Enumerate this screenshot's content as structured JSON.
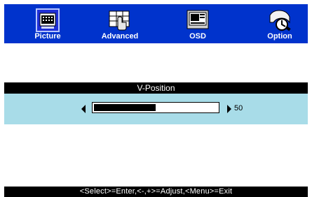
{
  "tabs": [
    {
      "label": "Picture",
      "icon": "picture-icon",
      "selected": true
    },
    {
      "label": "Advanced",
      "icon": "advanced-icon",
      "selected": false
    },
    {
      "label": "OSD",
      "icon": "osd-icon",
      "selected": false
    },
    {
      "label": "Option",
      "icon": "option-icon",
      "selected": false
    }
  ],
  "setting": {
    "title": "V-Position",
    "value": "50",
    "level_percent": 50
  },
  "footer": {
    "hint": "<Select>=Enter,<-,+>=Adjust,<Menu>=Exit"
  },
  "colors": {
    "menu_bar": "#0033cc",
    "adjust_row": "#a8dce8",
    "selected_icon_bg": "#1f2fd8"
  }
}
